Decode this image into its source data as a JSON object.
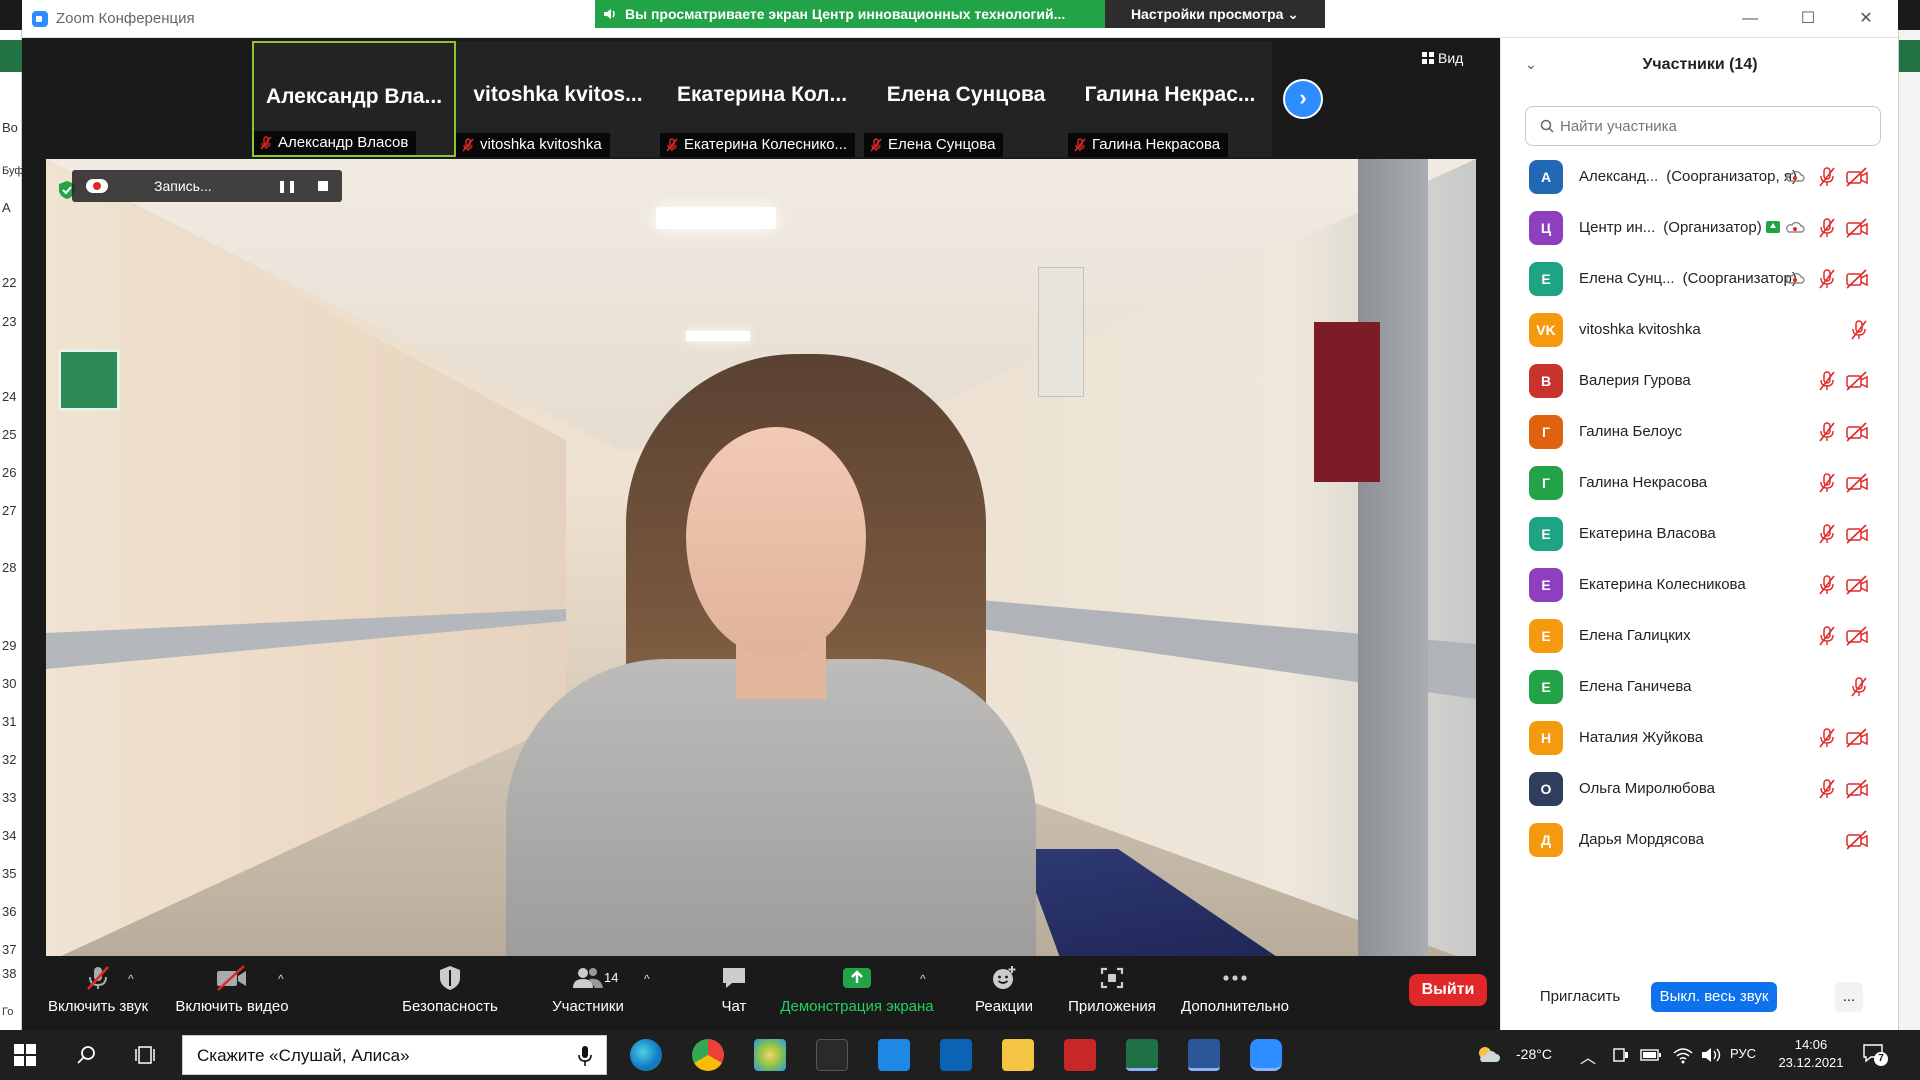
{
  "window": {
    "title": "Zoom Конференция",
    "minimize": "—",
    "maximize": "☐",
    "close": "✕"
  },
  "share_banner": {
    "text": "Вы просматриваете экран Центр инновационных технологий...",
    "view_settings": "Настройки просмотра ⌄"
  },
  "background_app": {
    "row_numbers": [
      "22",
      "23",
      "24",
      "25",
      "26",
      "27",
      "28",
      "29",
      "30",
      "31",
      "32",
      "33",
      "34",
      "35",
      "36",
      "37",
      "38"
    ],
    "left_labels": [
      "Во",
      "Буф",
      "А",
      "Го"
    ]
  },
  "gallery": {
    "thumbnails": [
      {
        "big": "Александр Вла...",
        "label": "Александр Власов",
        "active": true
      },
      {
        "big": "vitoshka kvitos...",
        "label": "vitoshka kvitoshka",
        "active": false
      },
      {
        "big": "Екатерина Кол...",
        "label": "Екатерина Колеснико...",
        "active": false
      },
      {
        "big": "Елена Сунцова",
        "label": "Елена Сунцова",
        "active": false
      },
      {
        "big": "Галина Некрас...",
        "label": "Галина Некрасова",
        "active": false
      }
    ],
    "view_label": "Вид",
    "next": "›"
  },
  "recording": {
    "label": "Запись...",
    "pause": "❚❚"
  },
  "toolbar": {
    "mute": "Включить звук",
    "video": "Включить видео",
    "security": "Безопасность",
    "participants": "Участники",
    "participants_count": "14",
    "chat": "Чат",
    "share": "Демонстрация экрана",
    "reactions": "Реакции",
    "apps": "Приложения",
    "more": "Дополнительно",
    "leave": "Выйти",
    "caret": "^"
  },
  "participants_panel": {
    "title": "Участники (14)",
    "search_placeholder": "Найти участника",
    "invite": "Пригласить",
    "mute_all": "Выкл. весь звук",
    "more": "...",
    "people": [
      {
        "initials": "А",
        "color": "#2268b5",
        "name": "Александ...",
        "role": "(Соорганизатор, я)",
        "cloud": true,
        "share": false,
        "mic": true,
        "cam": true
      },
      {
        "initials": "Ц",
        "color": "#8e3fbe",
        "name": "Центр ин...",
        "role": "(Организатор)",
        "cloud": true,
        "share": true,
        "mic": true,
        "cam": true
      },
      {
        "initials": "Е",
        "color": "#1ea385",
        "name": "Елена Сунц...",
        "role": "(Соорганизатор)",
        "cloud": true,
        "share": false,
        "mic": true,
        "cam": true
      },
      {
        "initials": "VK",
        "color": "#f59a0f",
        "name": "vitoshka kvitoshka",
        "role": "",
        "cloud": false,
        "share": false,
        "mic": true,
        "cam": false
      },
      {
        "initials": "В",
        "color": "#c8332e",
        "name": "Валерия Гурова",
        "role": "",
        "cloud": false,
        "share": false,
        "mic": true,
        "cam": true
      },
      {
        "initials": "Г",
        "color": "#e0620e",
        "name": "Галина Белоус",
        "role": "",
        "cloud": false,
        "share": false,
        "mic": true,
        "cam": true
      },
      {
        "initials": "Г",
        "color": "#23a347",
        "name": "Галина Некрасова",
        "role": "",
        "cloud": false,
        "share": false,
        "mic": true,
        "cam": true
      },
      {
        "initials": "Е",
        "color": "#1ea385",
        "name": "Екатерина Власова",
        "role": "",
        "cloud": false,
        "share": false,
        "mic": true,
        "cam": true
      },
      {
        "initials": "Е",
        "color": "#8e3fbe",
        "name": "Екатерина Колесникова",
        "role": "",
        "cloud": false,
        "share": false,
        "mic": true,
        "cam": true
      },
      {
        "initials": "Е",
        "color": "#f59a0f",
        "name": "Елена Галицких",
        "role": "",
        "cloud": false,
        "share": false,
        "mic": true,
        "cam": true
      },
      {
        "initials": "Е",
        "color": "#23a347",
        "name": "Елена Ганичева",
        "role": "",
        "cloud": false,
        "share": false,
        "mic": true,
        "cam": false
      },
      {
        "initials": "Н",
        "color": "#f59a0f",
        "name": "Наталия Жуйкова",
        "role": "",
        "cloud": false,
        "share": false,
        "mic": true,
        "cam": true
      },
      {
        "initials": "О",
        "color": "#2f3e5c",
        "name": "Ольга Миролюбова",
        "role": "",
        "cloud": false,
        "share": false,
        "mic": true,
        "cam": true
      },
      {
        "initials": "Д",
        "color": "#f59a0f",
        "name": "Дарья Мордясова",
        "role": "",
        "cloud": false,
        "share": false,
        "mic": false,
        "cam": true
      }
    ]
  },
  "taskbar": {
    "search_text": "Скажите «Слушай, Алиса»",
    "temperature": "-28°C",
    "language": "РУС",
    "time": "14:06",
    "date": "23.12.2021",
    "notifications": "7"
  },
  "colors": {
    "zoom_blue": "#2d8cff",
    "share_green": "#23a347",
    "leave_red": "#e02828",
    "mute_all_blue": "#0e72ed"
  }
}
